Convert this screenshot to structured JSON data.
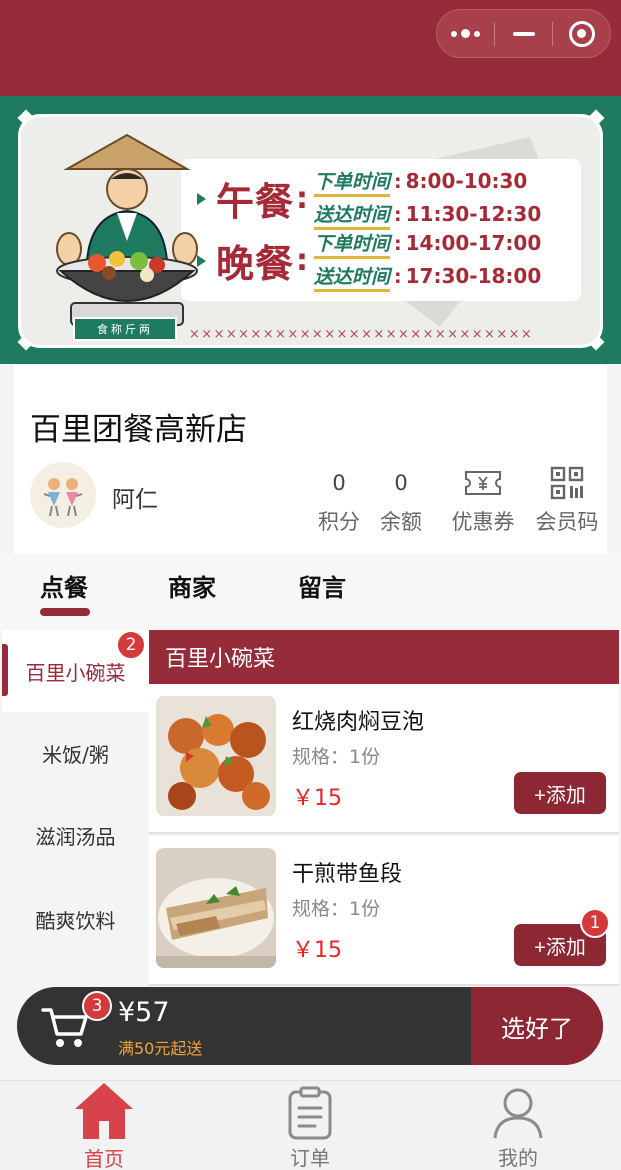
{
  "colors": {
    "brand": "#962b39",
    "price": "#ee2222",
    "banner_green": "#1e7b60",
    "badge": "#d43a3a",
    "min_order": "#f2a233"
  },
  "titlebar": {
    "icons": [
      "more-dots-icon",
      "minimize-icon",
      "close-target-icon"
    ]
  },
  "banner": {
    "lunch": {
      "name": "午餐",
      "order_label": "下单时间",
      "order_time": "8:00-10:30",
      "deliver_label": "送达时间",
      "deliver_time": "11:30-12:30"
    },
    "dinner": {
      "name": "晚餐",
      "order_label": "下单时间",
      "order_time": "14:00-17:00",
      "deliver_label": "送达时间",
      "deliver_time": "17:30-18:00"
    },
    "scale_text": "食称斤两",
    "cross_row": "××××××××××××××××××××××××××××"
  },
  "store": {
    "name": "百里团餐高新店",
    "user_name": "阿仁",
    "points_value": "0",
    "points_label": "积分",
    "balance_value": "0",
    "balance_label": "余额",
    "coupon_label": "优惠券",
    "member_code_label": "会员码"
  },
  "tabs": [
    "点餐",
    "商家",
    "留言"
  ],
  "categories": [
    {
      "label": "百里小碗菜",
      "badge": "2"
    },
    {
      "label": "米饭/粥"
    },
    {
      "label": "滋润汤品"
    },
    {
      "label": "酷爽饮料"
    }
  ],
  "section_title": "百里小碗菜",
  "products": [
    {
      "name": "红烧肉焖豆泡",
      "spec": "规格：1份",
      "price": "￥15",
      "add_label": "+添加"
    },
    {
      "name": "干煎带鱼段",
      "spec": "规格：1份",
      "price": "￥15",
      "add_label": "+添加",
      "badge": "1"
    }
  ],
  "cart": {
    "count": "3",
    "total": "¥57",
    "min_order": "满50元起送",
    "checkout_label": "选好了"
  },
  "bottom_nav": [
    {
      "label": "首页",
      "icon": "home-icon"
    },
    {
      "label": "订单",
      "icon": "order-clipboard-icon"
    },
    {
      "label": "我的",
      "icon": "user-icon"
    }
  ]
}
